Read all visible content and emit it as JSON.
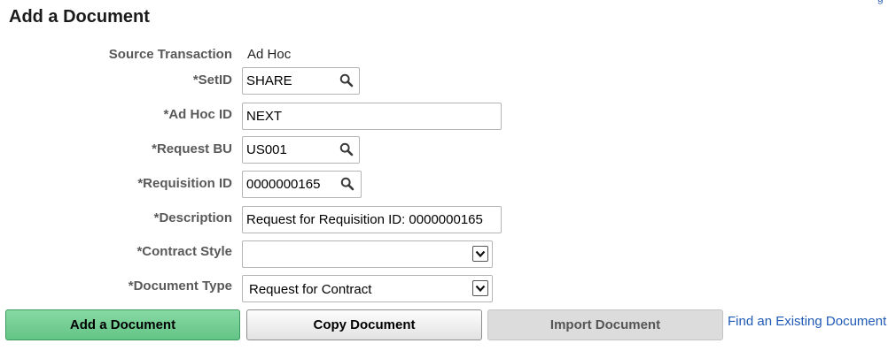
{
  "page": {
    "title": "Add a Document"
  },
  "form": {
    "source_transaction": {
      "label": "Source Transaction",
      "value": "Ad Hoc"
    },
    "setid": {
      "label": "*SetID",
      "value": "SHARE"
    },
    "ad_hoc_id": {
      "label": "*Ad Hoc ID",
      "value": "NEXT"
    },
    "request_bu": {
      "label": "*Request BU",
      "value": "US001"
    },
    "requisition_id": {
      "label": "*Requisition ID",
      "value": "0000000165"
    },
    "description": {
      "label": "*Description",
      "value": "Request for Requisition ID: 0000000165"
    },
    "contract_style": {
      "label": "*Contract Style",
      "value": ""
    },
    "document_type": {
      "label": "*Document Type",
      "value": "Request for Contract"
    }
  },
  "actions": {
    "add_document": "Add a Document",
    "copy_document": "Copy Document",
    "import_document": "Import Document",
    "find_existing": "Find an Existing Document"
  },
  "icons": {
    "lookup": "search-icon",
    "dropdown": "chevron-down-icon"
  },
  "colors": {
    "primary_button": "#72cd91",
    "link": "#1f5ab5",
    "label": "#595959"
  }
}
